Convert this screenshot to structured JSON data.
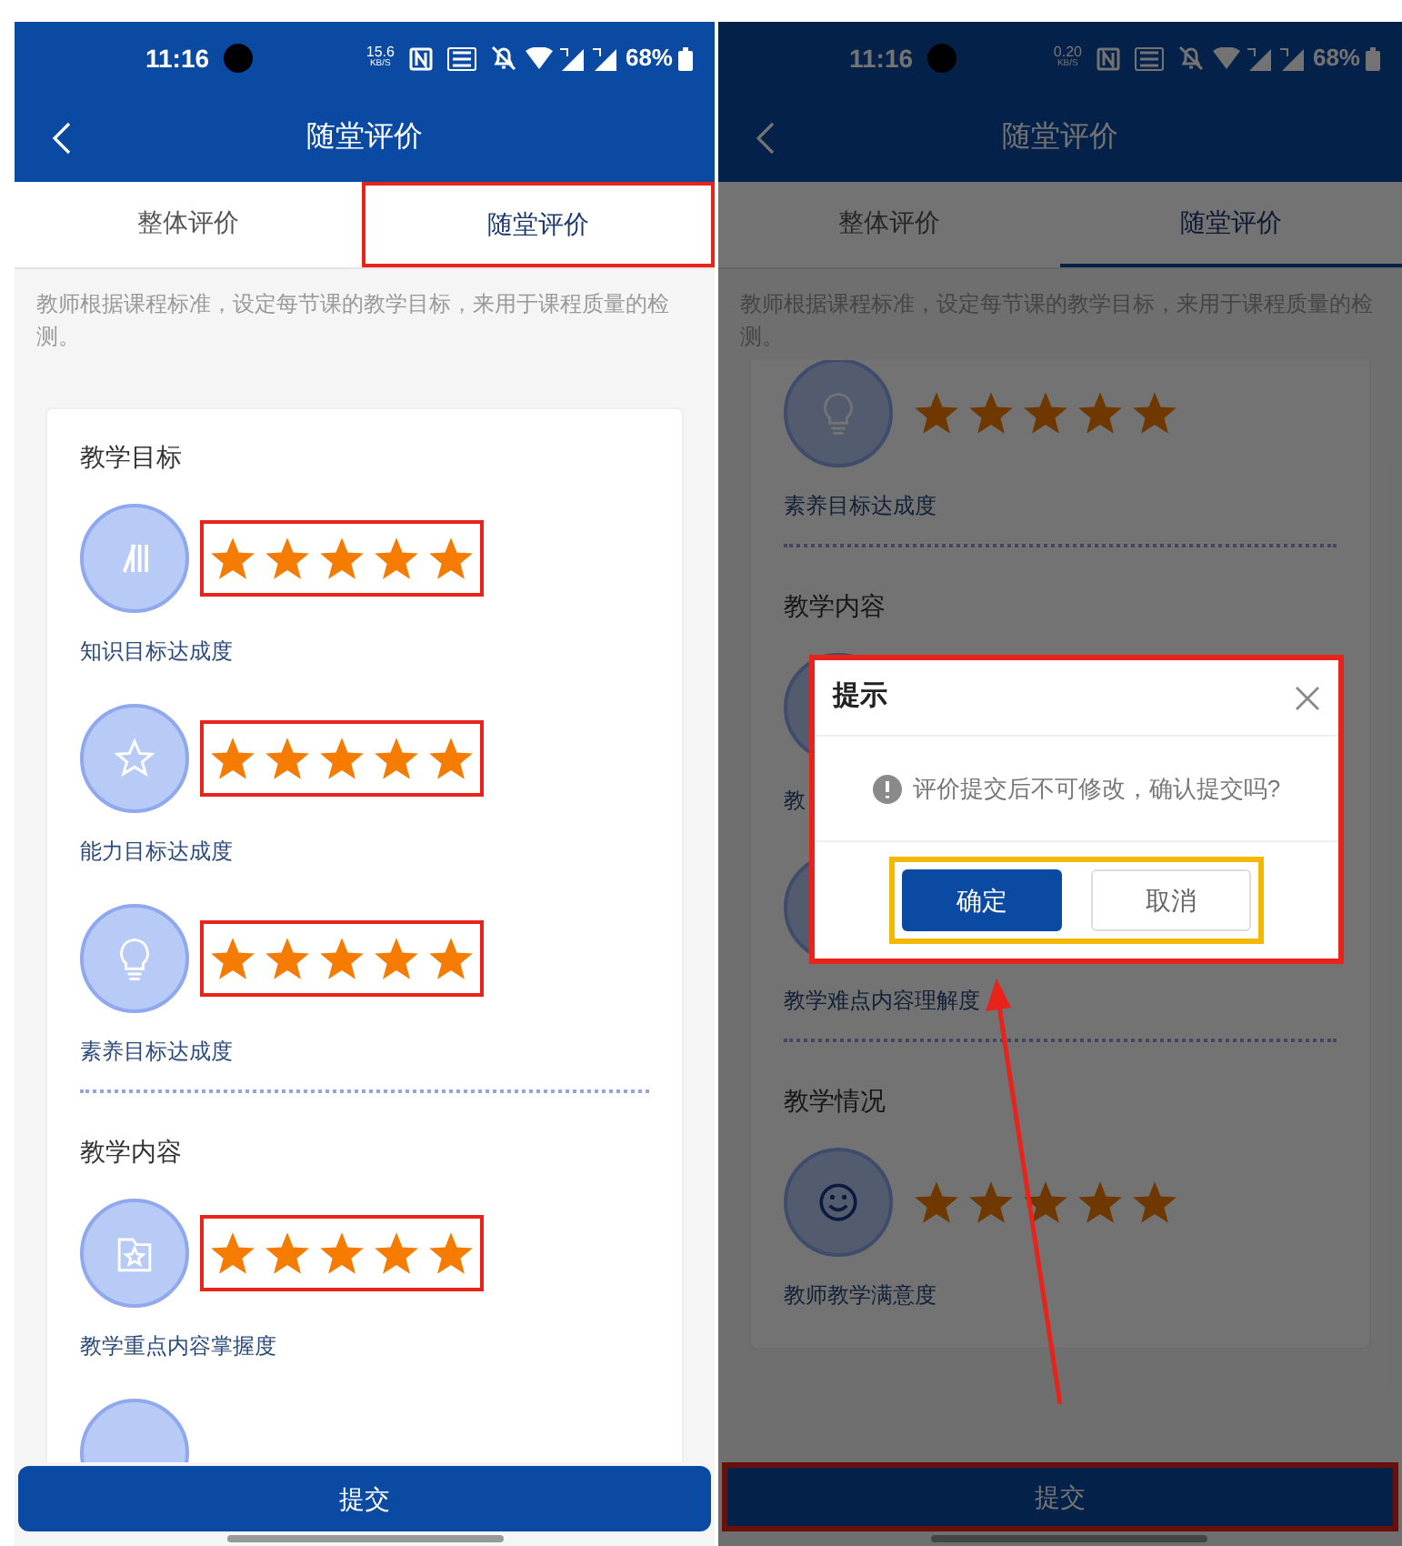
{
  "panels": [
    {
      "status_bar": {
        "time": "11:16",
        "net_speed": "15.6",
        "net_unit": "KB/S",
        "battery": "68%"
      },
      "nav": {
        "title": "随堂评价"
      },
      "tabs": [
        {
          "label": "整体评价",
          "selected": false,
          "annotated": false
        },
        {
          "label": "随堂评价",
          "selected": true,
          "annotated": true
        }
      ],
      "description": "教师根据课程标准，设定每节课的教学目标，来用于课程质量的检测。",
      "sections": [
        {
          "title": "教学目标",
          "items": [
            {
              "kind": "knowledge",
              "stars": 5,
              "annotated": true,
              "label": "知识目标达成度"
            },
            {
              "kind": "ability",
              "stars": 5,
              "annotated": true,
              "label": "能力目标达成度"
            },
            {
              "kind": "literacy",
              "stars": 5,
              "annotated": true,
              "label": "素养目标达成度"
            }
          ]
        },
        {
          "title": "教学内容",
          "items": [
            {
              "kind": "keypoint",
              "stars": 5,
              "annotated": true,
              "label": "教学重点内容掌握度"
            },
            {
              "kind": "difficulty"
            }
          ]
        }
      ],
      "submit": {
        "label": "提交",
        "annotated": false
      }
    },
    {
      "status_bar": {
        "time": "11:16",
        "net_speed": "0.20",
        "net_unit": "KB/S",
        "battery": "68%"
      },
      "nav": {
        "title": "随堂评价"
      },
      "tabs": [
        {
          "label": "整体评价",
          "selected": false,
          "annotated": false
        },
        {
          "label": "随堂评价",
          "selected": true,
          "annotated": false
        }
      ],
      "description": "教师根据课程标准，设定每节课的教学目标，来用于课程质量的检测。",
      "sections": [
        {
          "items": [
            {
              "kind": "literacy",
              "stars": 5,
              "label": "素养目标达成度"
            }
          ]
        },
        {
          "title": "教学内容",
          "items": [
            {
              "kind": "keypoint",
              "label": "教"
            },
            {
              "kind": "difficulty",
              "label": "教学难点内容理解度"
            }
          ]
        },
        {
          "title": "教学情况",
          "items": [
            {
              "kind": "satisfaction",
              "stars": 5,
              "label": "教师教学满意度"
            }
          ]
        }
      ],
      "submit": {
        "label": "提交",
        "annotated": true
      },
      "dialog": {
        "title": "提示",
        "message": "评价提交后不可修改，确认提交吗?",
        "annotated": true,
        "buttons_annotated": true,
        "buttons": [
          {
            "label": "确定",
            "kind": "primary"
          },
          {
            "label": "取消",
            "kind": "secondary"
          }
        ]
      },
      "annotation_arrow": true
    }
  ]
}
